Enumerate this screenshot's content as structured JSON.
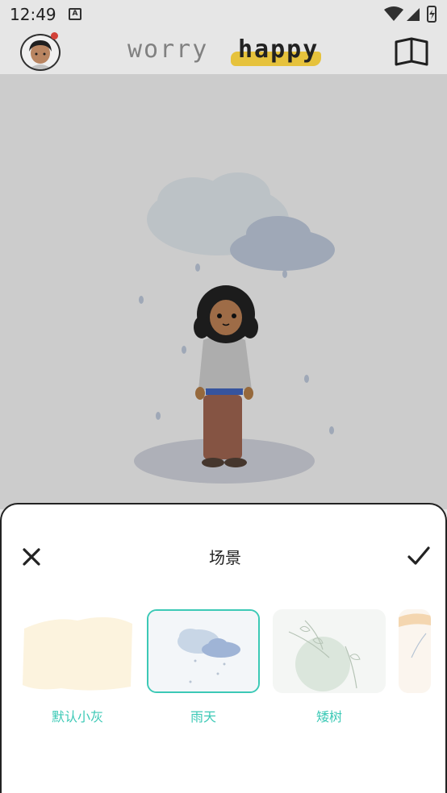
{
  "status_bar": {
    "time": "12:49",
    "a_label": "A"
  },
  "header": {
    "tab_worry": "worry",
    "tab_happy": "happy"
  },
  "sheet": {
    "title": "场景",
    "scenes": [
      {
        "label": "默认小灰",
        "selected": false
      },
      {
        "label": "雨天",
        "selected": true
      },
      {
        "label": "矮树",
        "selected": false
      },
      {
        "label": "",
        "selected": false
      }
    ]
  },
  "colors": {
    "accent": "#3cc9b6",
    "highlight": "#e6c23c",
    "notification": "#e0463c"
  },
  "icons": [
    "wifi-icon",
    "cell-signal-icon",
    "battery-icon",
    "avatar",
    "book-icon",
    "close-icon",
    "check-icon"
  ]
}
